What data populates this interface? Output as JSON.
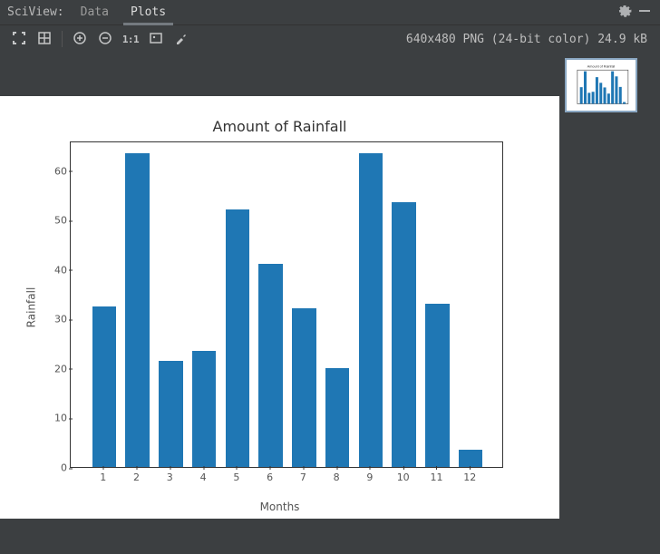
{
  "tabbar": {
    "title": "SciView:",
    "tabs": [
      {
        "label": "Data",
        "active": false
      },
      {
        "label": "Plots",
        "active": true
      }
    ]
  },
  "toolbar": {
    "status": "640x480 PNG (24-bit color) 24.9 kB",
    "one_to_one": "1:1"
  },
  "chart_data": {
    "type": "bar",
    "title": "Amount of Rainfall",
    "xlabel": "Months",
    "ylabel": "Rainfall",
    "categories": [
      "1",
      "2",
      "3",
      "4",
      "5",
      "6",
      "7",
      "8",
      "9",
      "10",
      "11",
      "12"
    ],
    "values": [
      32.5,
      63.5,
      21.5,
      23.5,
      52,
      41,
      32,
      20,
      63.5,
      53.5,
      33,
      3.5
    ],
    "yticks": [
      0,
      10,
      20,
      30,
      40,
      50,
      60
    ],
    "ylim": [
      0,
      66
    ],
    "bar_color": "#1f77b4"
  },
  "thumbnails": [
    {
      "label": "Amount of Rainfall"
    }
  ]
}
